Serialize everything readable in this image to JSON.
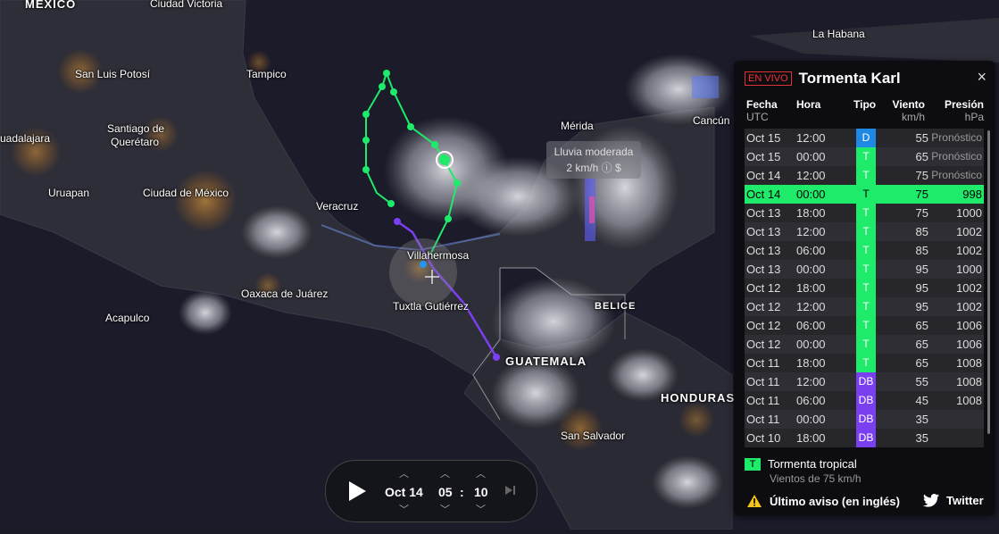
{
  "map": {
    "labels": [
      {
        "id": "mexico",
        "text": "MÉXICO",
        "kind": "country"
      },
      {
        "id": "cvictoria",
        "text": "Ciudad Victoria"
      },
      {
        "id": "tampico",
        "text": "Tampico"
      },
      {
        "id": "slp",
        "text": "San Luis Potosí"
      },
      {
        "id": "qro1",
        "text": "Santiago de"
      },
      {
        "id": "qro2",
        "text": "Querétaro"
      },
      {
        "id": "gdl",
        "text": "uadalajara"
      },
      {
        "id": "uruapan",
        "text": "Uruapan"
      },
      {
        "id": "cdmx",
        "text": "Ciudad de México"
      },
      {
        "id": "veracruz",
        "text": "Veracruz"
      },
      {
        "id": "villahermosa",
        "text": "Villahermosa"
      },
      {
        "id": "oaxaca",
        "text": "Oaxaca de Juárez"
      },
      {
        "id": "acapulco",
        "text": "Acapulco"
      },
      {
        "id": "tuxtla",
        "text": "Tuxtla Gutiérrez"
      },
      {
        "id": "belice",
        "text": "BELICE",
        "kind": "country"
      },
      {
        "id": "guatemala",
        "text": "GUATEMALA",
        "kind": "country"
      },
      {
        "id": "honduras",
        "text": "HONDURAS",
        "kind": "country"
      },
      {
        "id": "sansalvador",
        "text": "San Salvador"
      },
      {
        "id": "merida",
        "text": "Mérida"
      },
      {
        "id": "cancun",
        "text": "Cancún"
      },
      {
        "id": "habana",
        "text": "La Habana"
      }
    ],
    "rain_tooltip": {
      "line1": "Lluvia moderada",
      "line2": "2 km/h ⓘ $"
    },
    "track_colors": {
      "tropical_storm": "#1eeb6a",
      "depression": "#7b3ff2"
    }
  },
  "panel": {
    "live_badge": "EN VIVO",
    "title": "Tormenta Karl",
    "close": "×",
    "headers": {
      "fecha": "Fecha",
      "fecha_sub": "UTC",
      "hora": "Hora",
      "tipo": "Tipo",
      "viento": "Viento",
      "viento_sub": "km/h",
      "presion": "Presión",
      "presion_sub": "hPa"
    },
    "rows": [
      {
        "fecha": "Oct 15",
        "hora": "12:00",
        "tipo": "D",
        "viento": "55",
        "presion": "Pronóstico",
        "forecast": true,
        "color": "#1e88e5"
      },
      {
        "fecha": "Oct 15",
        "hora": "00:00",
        "tipo": "T",
        "viento": "65",
        "presion": "Pronóstico",
        "forecast": true,
        "color": "#1eeb6a"
      },
      {
        "fecha": "Oct 14",
        "hora": "12:00",
        "tipo": "T",
        "viento": "75",
        "presion": "Pronóstico",
        "forecast": true,
        "color": "#1eeb6a"
      },
      {
        "fecha": "Oct 14",
        "hora": "00:00",
        "tipo": "T",
        "viento": "75",
        "presion": "998",
        "selected": true,
        "color": "#1eeb6a"
      },
      {
        "fecha": "Oct 13",
        "hora": "18:00",
        "tipo": "T",
        "viento": "75",
        "presion": "1000",
        "color": "#1eeb6a"
      },
      {
        "fecha": "Oct 13",
        "hora": "12:00",
        "tipo": "T",
        "viento": "85",
        "presion": "1002",
        "color": "#1eeb6a"
      },
      {
        "fecha": "Oct 13",
        "hora": "06:00",
        "tipo": "T",
        "viento": "85",
        "presion": "1002",
        "color": "#1eeb6a"
      },
      {
        "fecha": "Oct 13",
        "hora": "00:00",
        "tipo": "T",
        "viento": "95",
        "presion": "1000",
        "color": "#1eeb6a"
      },
      {
        "fecha": "Oct 12",
        "hora": "18:00",
        "tipo": "T",
        "viento": "95",
        "presion": "1002",
        "color": "#1eeb6a"
      },
      {
        "fecha": "Oct 12",
        "hora": "12:00",
        "tipo": "T",
        "viento": "95",
        "presion": "1002",
        "color": "#1eeb6a"
      },
      {
        "fecha": "Oct 12",
        "hora": "06:00",
        "tipo": "T",
        "viento": "65",
        "presion": "1006",
        "color": "#1eeb6a"
      },
      {
        "fecha": "Oct 12",
        "hora": "00:00",
        "tipo": "T",
        "viento": "65",
        "presion": "1006",
        "color": "#1eeb6a"
      },
      {
        "fecha": "Oct 11",
        "hora": "18:00",
        "tipo": "T",
        "viento": "65",
        "presion": "1008",
        "color": "#1eeb6a"
      },
      {
        "fecha": "Oct 11",
        "hora": "12:00",
        "tipo": "DB",
        "viento": "55",
        "presion": "1008",
        "color": "#7b3ff2"
      },
      {
        "fecha": "Oct 11",
        "hora": "06:00",
        "tipo": "DB",
        "viento": "45",
        "presion": "1008",
        "color": "#7b3ff2"
      },
      {
        "fecha": "Oct 11",
        "hora": "00:00",
        "tipo": "DB",
        "viento": "35",
        "presion": "",
        "color": "#7b3ff2"
      },
      {
        "fecha": "Oct 10",
        "hora": "18:00",
        "tipo": "DB",
        "viento": "35",
        "presion": "",
        "color": "#7b3ff2"
      }
    ],
    "legend": {
      "badge": "T",
      "label": "Tormenta tropical",
      "sub": "Vientos de 75 km/h"
    },
    "warning": "Último aviso (en inglés)",
    "twitter": "Twitter"
  },
  "player": {
    "date": "Oct 14",
    "hour": "05",
    "minute": "10",
    "separator": ":"
  }
}
